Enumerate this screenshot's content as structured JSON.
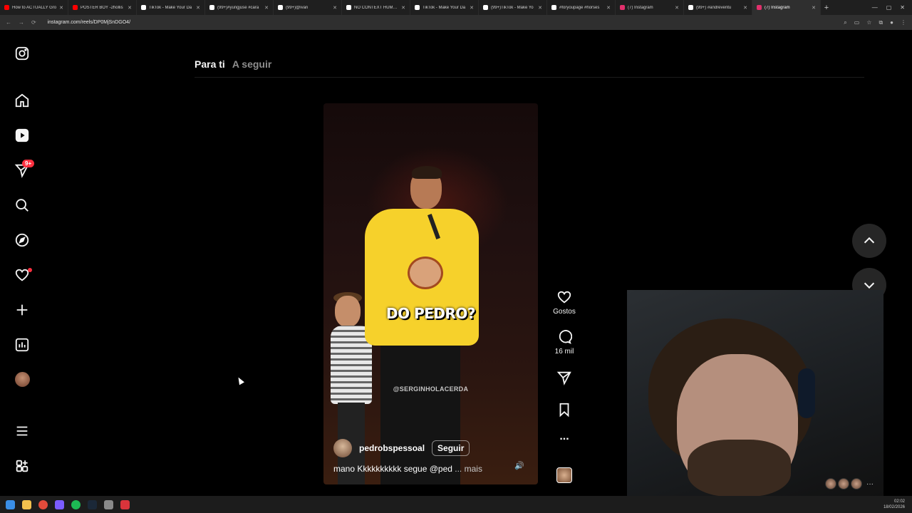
{
  "browser": {
    "tabs": [
      {
        "title": "How to ACTUALLY Gro",
        "color": "#ff0000"
      },
      {
        "title": "POSTER BOY -2hollis",
        "color": "#ff0000"
      },
      {
        "title": "TikTok - Make Your Da",
        "color": "#ffffff"
      },
      {
        "title": "(99+)#yungjuse #cara",
        "color": "#ffffff"
      },
      {
        "title": "(99+)@ivan",
        "color": "#ffffff"
      },
      {
        "title": "NO CONTEXT HUMAN",
        "color": "#ffffff"
      },
      {
        "title": "TikTok - Make Your Da",
        "color": "#ffffff"
      },
      {
        "title": "(99+)TikTok - Make Yo",
        "color": "#ffffff"
      },
      {
        "title": "#foryoupage #horses",
        "color": "#ffffff"
      },
      {
        "title": "(7) Instagram",
        "color": "#e1306c"
      },
      {
        "title": "(99+) #andreventu",
        "color": "#ffffff"
      },
      {
        "title": "(7) Instagram",
        "color": "#e1306c",
        "active": true
      }
    ],
    "url": "instagram.com/reels/DP0MjSnDGO4/"
  },
  "sidebar": {
    "icons": [
      "instagram-logo-icon",
      "home-icon",
      "reels-icon",
      "messages-icon",
      "search-icon",
      "explore-icon",
      "notifications-icon",
      "create-icon",
      "dashboard-icon",
      "profile-avatar",
      "menu-icon",
      "more-apps-icon"
    ],
    "messages_badge": "9+"
  },
  "feed_tabs": {
    "for_you": "Para ti",
    "following": "A seguir"
  },
  "reel": {
    "caption_overlay": "DO PEDRO?",
    "watermark": "@SERGINHOLACERDA",
    "author": "pedrobspessoal",
    "follow_label": "Seguir",
    "description": "mano Kkkkkkkkkk segue @ped",
    "more_label": "... mais"
  },
  "actions": {
    "likes_label": "Gostos",
    "comments_count": "16 mil",
    "more": "..."
  },
  "taskbar": {
    "time": "02:02",
    "date": "18/02/2026"
  },
  "colors": {
    "background": "#000000",
    "badge": "#ff3040",
    "shirt": "#f6d12b"
  }
}
